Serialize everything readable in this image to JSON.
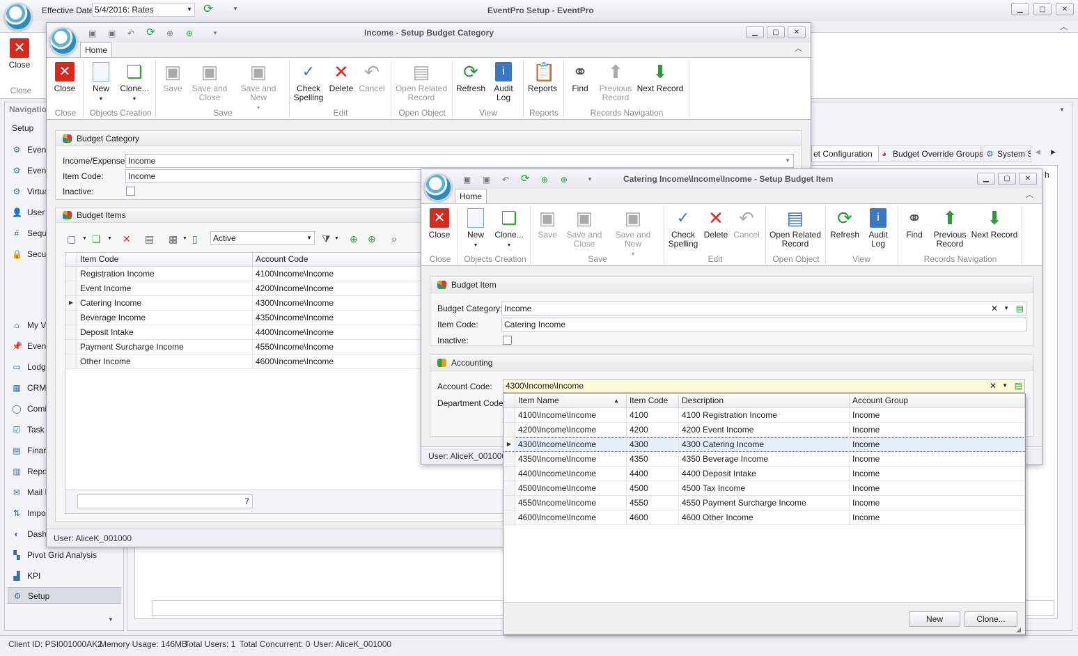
{
  "main": {
    "title": "EventPro Setup - EventPro",
    "effective_date_label": "Effective Date",
    "effective_date_value": "5/4/2016: Rates",
    "close_label": "Close",
    "close_group": "Close",
    "nav_header": "Navigatio",
    "setup_label": "Setup",
    "nav_items_top": [
      "Even",
      "Even",
      "Virtua",
      "User",
      "Sequ",
      "Secu"
    ],
    "nav_items_bottom": [
      "My V",
      "Even",
      "Lodg",
      "CRM",
      "Comi",
      "Task",
      "Finar",
      "Repo",
      "Mail I",
      "Impo",
      "Dash",
      "Pivot Grid Analysis",
      "KPI",
      "Setup"
    ],
    "tabs": [
      "et Configuration",
      "Budget Override Groups",
      "System S"
    ],
    "search_fragment": "h",
    "status": {
      "client_id": "Client ID: PSI001000AK2",
      "memory": "Memory Usage: 146MB",
      "total_users": "Total Users: 1",
      "total_concurrent": "Total Concurrent: 0",
      "user": "User: AliceK_001000"
    }
  },
  "category": {
    "title": "Income - Setup Budget Category",
    "tab_home": "Home",
    "ribbon": {
      "close": "Close",
      "new": "New",
      "clone": "Clone...",
      "save": "Save",
      "save_close": "Save and Close",
      "save_new": "Save and New",
      "check": "Check Spelling",
      "delete": "Delete",
      "cancel": "Cancel",
      "open_related": "Open Related Record",
      "refresh": "Refresh",
      "audit": "Audit Log",
      "reports": "Reports",
      "find": "Find",
      "prev": "Previous Record",
      "next": "Next Record"
    },
    "groups": {
      "close": "Close",
      "objects": "Objects Creation",
      "save": "Save",
      "edit": "Edit",
      "open": "Open Object",
      "view": "View",
      "reports": "Reports",
      "nav": "Records Navigation"
    },
    "panel_title": "Budget Category",
    "income_expense_label": "Income/Expense:",
    "income_expense_value": "Income",
    "item_code_label": "Item Code:",
    "item_code_value": "Income",
    "inactive_label": "Inactive:",
    "items_title": "Budget Items",
    "filter_value": "Active",
    "columns": [
      "Item Code",
      "Account Code"
    ],
    "rows": [
      [
        "Registration Income",
        "4100\\Income\\Income"
      ],
      [
        "Event Income",
        "4200\\Income\\Income"
      ],
      [
        "Catering Income",
        "4300\\Income\\Income"
      ],
      [
        "Beverage Income",
        "4350\\Income\\Income"
      ],
      [
        "Deposit Intake",
        "4400\\Income\\Income"
      ],
      [
        "Payment Surcharge Income",
        "4550\\Income\\Income"
      ],
      [
        "Other Income",
        "4600\\Income\\Income"
      ]
    ],
    "count": "7",
    "user": "User: AliceK_001000"
  },
  "item": {
    "title": "Catering Income\\Income\\Income - Setup Budget Item",
    "tab_home": "Home",
    "ribbon": {
      "close": "Close",
      "new": "New",
      "clone": "Clone...",
      "save": "Save",
      "save_close": "Save and Close",
      "save_new": "Save and New",
      "check": "Check Spelling",
      "delete": "Delete",
      "cancel": "Cancel",
      "open_related": "Open Related Record",
      "refresh": "Refresh",
      "audit": "Audit Log",
      "find": "Find",
      "prev": "Previous Record",
      "next": "Next Record"
    },
    "groups": {
      "close": "Close",
      "objects": "Objects Creation",
      "save": "Save",
      "edit": "Edit",
      "open": "Open Object",
      "view": "View",
      "nav": "Records Navigation"
    },
    "panel_title": "Budget Item",
    "category_label": "Budget Category:",
    "category_value": "Income",
    "item_code_label": "Item Code:",
    "item_code_value": "Catering Income",
    "inactive_label": "Inactive:",
    "accounting_title": "Accounting",
    "account_code_label": "Account Code:",
    "account_code_value": "4300\\Income\\Income",
    "department_label": "Department Code:",
    "user": "User: AliceK_001000"
  },
  "dropdown": {
    "columns": [
      "Item Name",
      "Item Code",
      "Description",
      "Account Group"
    ],
    "rows": [
      [
        "4100\\Income\\Income",
        "4100",
        "4100 Registration Income",
        "Income"
      ],
      [
        "4200\\Income\\Income",
        "4200",
        "4200 Event Income",
        "Income"
      ],
      [
        "4300\\Income\\Income",
        "4300",
        "4300 Catering Income",
        "Income"
      ],
      [
        "4350\\Income\\Income",
        "4350",
        "4350 Beverage Income",
        "Income"
      ],
      [
        "4400\\Income\\Income",
        "4400",
        "4400 Deposit Intake",
        "Income"
      ],
      [
        "4500\\Income\\Income",
        "4500",
        "4500 Tax Income",
        "Income"
      ],
      [
        "4550\\Income\\Income",
        "4550",
        "4550 Payment Surcharge Income",
        "Income"
      ],
      [
        "4600\\Income\\Income",
        "4600",
        "4600 Other Income",
        "Income"
      ]
    ],
    "new_label": "New",
    "clone_label": "Clone..."
  }
}
